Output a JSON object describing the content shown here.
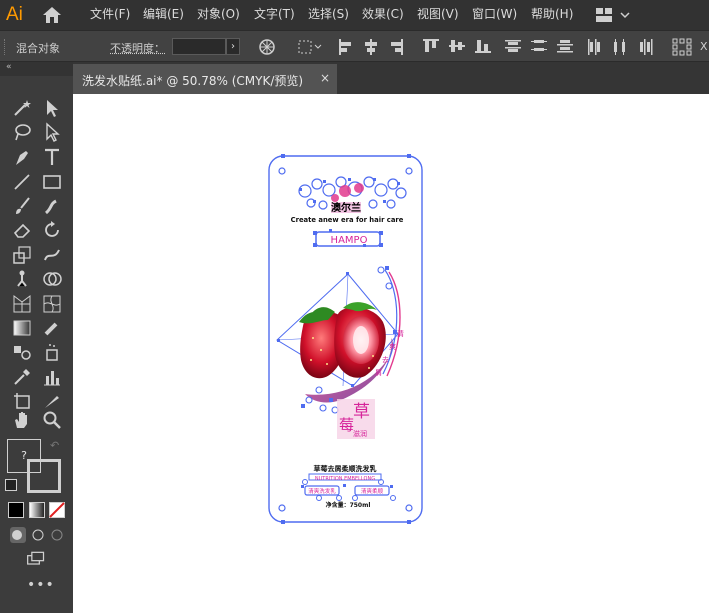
{
  "app": {
    "logo": "Ai"
  },
  "menu": {
    "file": "文件(F)",
    "edit": "编辑(E)",
    "object": "对象(O)",
    "type": "文字(T)",
    "select": "选择(S)",
    "effect": "效果(C)",
    "view": "视图(V)",
    "window": "窗口(W)",
    "help": "帮助(H)"
  },
  "control": {
    "selection_type": "混合对象",
    "opacity_label": "不透明度：",
    "opacity_value": ""
  },
  "document_tab": {
    "title": "洗发水贴纸.ai* @ 50.78% (CMYK/预览)",
    "close": "×"
  },
  "artwork": {
    "brand": "澳尔兰",
    "tagline": "Create anew era for hair care",
    "shampoo": "HAMPO",
    "fruit_char_1": "草",
    "fruit_char_2": "莓",
    "sub_label": "滋润",
    "side_chars": [
      "清",
      "爽",
      "去",
      "屑"
    ],
    "bottom_line": "草莓去屑柔顺洗发乳",
    "bottom_en": "NUTRITION EMBELLONG",
    "btn_left": "清爽洗发乳",
    "btn_right": "清爽柔顺",
    "volume": "净含量：750ml"
  },
  "colors": {
    "selection": "#4f6cf0",
    "accent": "#ff9a00",
    "brand_pink": "#d6249a"
  }
}
